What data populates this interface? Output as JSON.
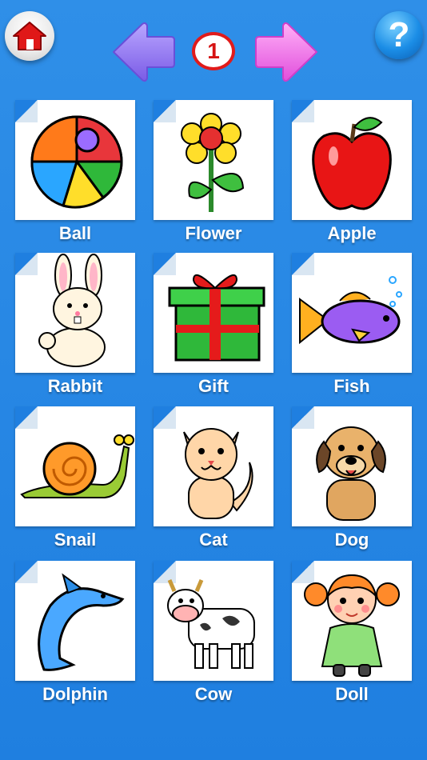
{
  "header": {
    "page_number": "1",
    "home_icon": "home-icon",
    "help_symbol": "?",
    "prev_icon": "left-arrow-icon",
    "next_icon": "right-arrow-icon",
    "colors": {
      "prev_arrow": "#8a6cf2",
      "next_arrow": "#f06be8",
      "badge_ring": "#e11b1b"
    }
  },
  "items": [
    {
      "label": "Ball",
      "icon": "ball-icon"
    },
    {
      "label": "Flower",
      "icon": "flower-icon"
    },
    {
      "label": "Apple",
      "icon": "apple-icon"
    },
    {
      "label": "Rabbit",
      "icon": "rabbit-icon"
    },
    {
      "label": "Gift",
      "icon": "gift-icon"
    },
    {
      "label": "Fish",
      "icon": "fish-icon"
    },
    {
      "label": "Snail",
      "icon": "snail-icon"
    },
    {
      "label": "Cat",
      "icon": "cat-icon"
    },
    {
      "label": "Dog",
      "icon": "dog-icon"
    },
    {
      "label": "Dolphin",
      "icon": "dolphin-icon"
    },
    {
      "label": "Cow",
      "icon": "cow-icon"
    },
    {
      "label": "Doll",
      "icon": "doll-icon"
    }
  ]
}
